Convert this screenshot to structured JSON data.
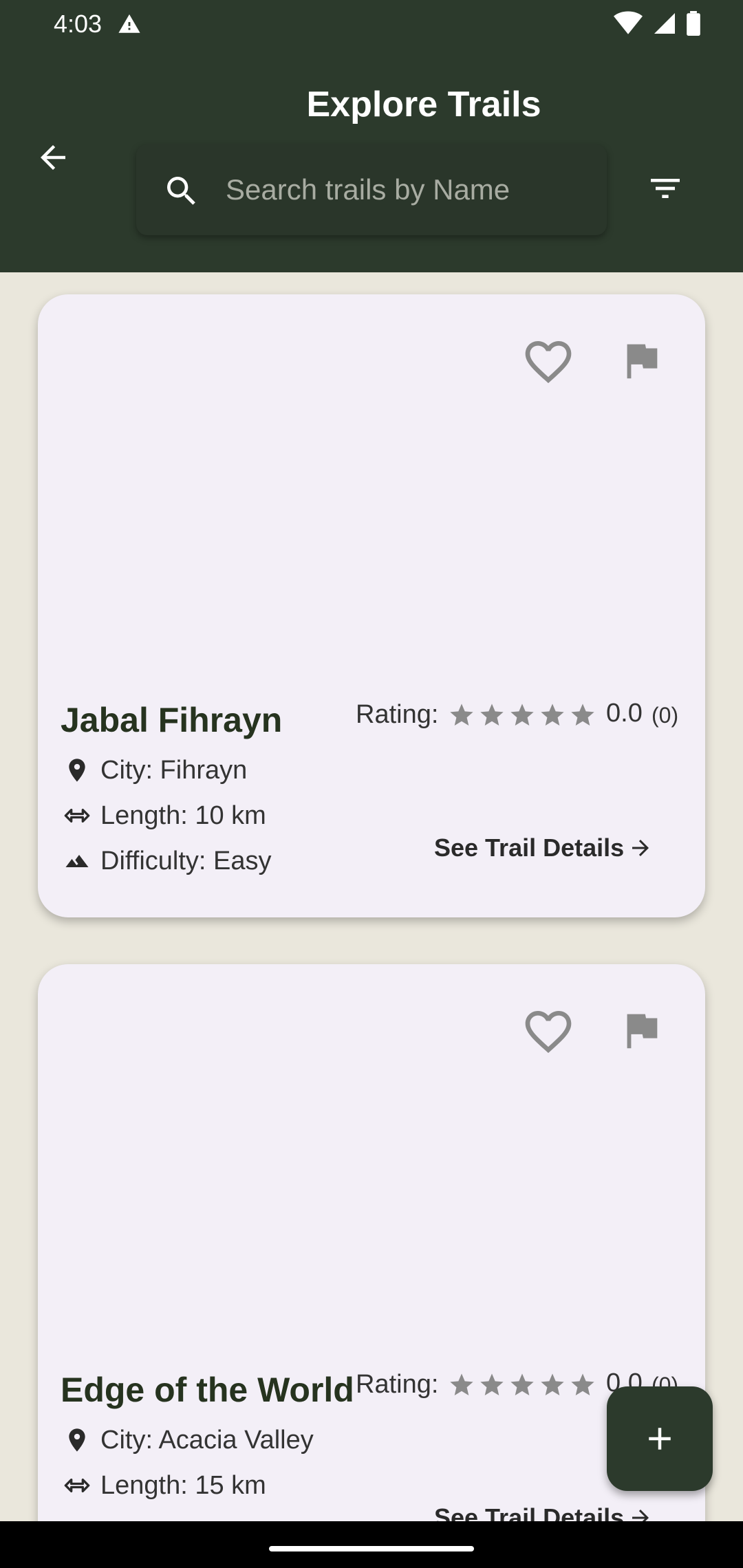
{
  "status_bar": {
    "time": "4:03",
    "icons": [
      "warning-icon",
      "wifi-icon",
      "signal-icon",
      "battery-icon"
    ]
  },
  "header": {
    "title": "Explore Trails",
    "back_icon": "arrow-back-icon",
    "filter_icon": "filter-icon"
  },
  "search": {
    "placeholder": "Search trails by Name",
    "value": ""
  },
  "trails": [
    {
      "name": "Jabal Fihrayn",
      "rating_label": "Rating:",
      "rating_value": "0.0",
      "rating_count": "(0)",
      "stars": 5,
      "city": "City: Fihrayn",
      "length": "Length: 10 km",
      "difficulty": "Difficulty: Easy",
      "details_label": "See Trail Details"
    },
    {
      "name": "Edge of the World",
      "rating_label": "Rating:",
      "rating_value": "0.0",
      "rating_count": "(0)",
      "stars": 5,
      "city": "City: Acacia Valley",
      "length": "Length: 15 km",
      "difficulty": "",
      "details_label": "See Trail Details"
    }
  ],
  "fab": {
    "icon": "plus-icon"
  },
  "colors": {
    "header_bg": "#2c3a2c",
    "page_bg": "#eae7dc",
    "card_bg": "#f3eff7",
    "title_text": "#26331f",
    "icon_gray": "#8a8a8a"
  }
}
